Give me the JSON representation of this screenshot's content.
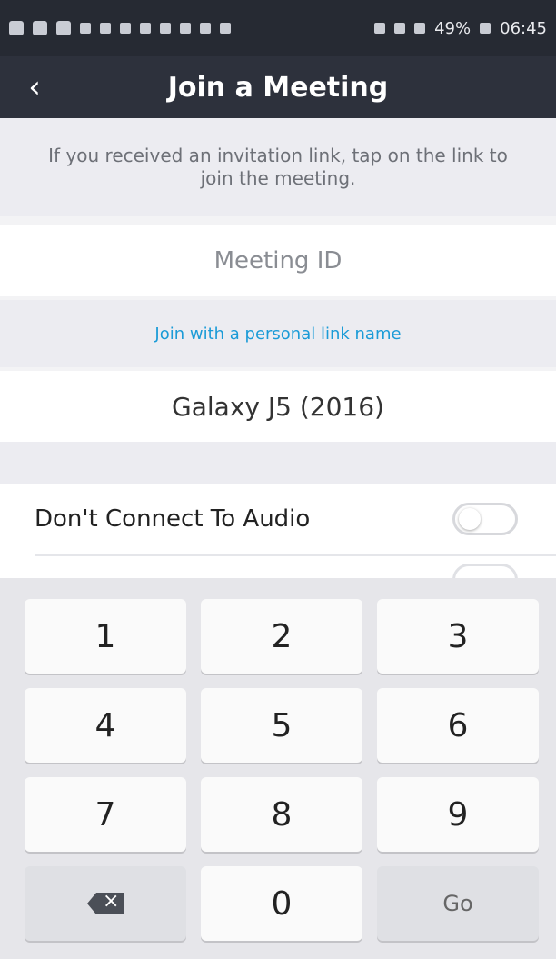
{
  "status": {
    "battery": "49%",
    "time": "06:45"
  },
  "app": {
    "title": "Join a Meeting"
  },
  "hint": "If you received an invitation link, tap on the link to join the meeting.",
  "meeting": {
    "placeholder": "Meeting ID",
    "link_label": "Join with a personal link name",
    "name_value": "Galaxy J5 (2016)"
  },
  "options": {
    "dont_connect_audio": "Don't Connect To Audio"
  },
  "keypad": {
    "keys": [
      "1",
      "2",
      "3",
      "4",
      "5",
      "6",
      "7",
      "8",
      "9",
      "0"
    ],
    "go": "Go"
  }
}
